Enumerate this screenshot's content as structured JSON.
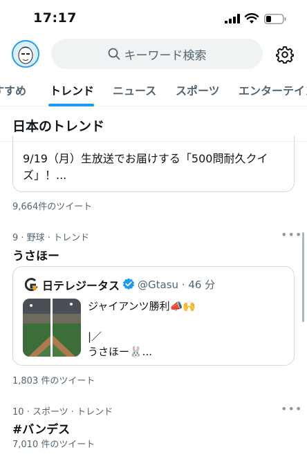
{
  "status_bar": {
    "time": "17:17"
  },
  "header": {
    "search_placeholder": "キーワード検索"
  },
  "tabs": [
    {
      "label": "すすめ"
    },
    {
      "label": "トレンド"
    },
    {
      "label": "ニュース"
    },
    {
      "label": "スポーツ"
    },
    {
      "label": "エンターテイン"
    }
  ],
  "section": {
    "title": "日本のトレンド"
  },
  "trend_prev": {
    "card_text_line1": "9/19（月）生放送でお届けする「500問耐久クイ",
    "card_text_line2": "ズ」！...",
    "tweet_count": "9,664件のツイート"
  },
  "trend_9": {
    "meta": "9 · 野球 · トレンド",
    "name": "うさほー",
    "tweet": {
      "account_name": "日テレジータス",
      "handle": "@Gtasu · 46 分",
      "text": "ジャイアンツ勝利📣🙌\n\n|／\nうさほー🐰..."
    },
    "tweet_count": "1,803 件のツイート"
  },
  "trend_10": {
    "meta": "10 · スポーツ · トレンド",
    "name": "#バンデス",
    "tweet_count": "7,010 件のツイート"
  },
  "more_label": "•••",
  "colors": {
    "accent": "#1d9bf0",
    "text": "#0f1419",
    "secondary": "#536471"
  }
}
